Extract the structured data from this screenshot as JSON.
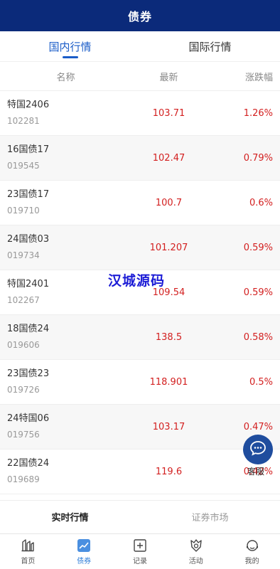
{
  "header": {
    "title": "债券"
  },
  "tabs": [
    {
      "label": "国内行情",
      "active": true
    },
    {
      "label": "国际行情",
      "active": false
    }
  ],
  "columns": {
    "name": "名称",
    "latest": "最新",
    "change": "涨跌幅"
  },
  "rows": [
    {
      "name": "特国2406",
      "code": "102281",
      "price": "103.71",
      "change": "1.26%"
    },
    {
      "name": "16国债17",
      "code": "019545",
      "price": "102.47",
      "change": "0.79%"
    },
    {
      "name": "23国债17",
      "code": "019710",
      "price": "100.7",
      "change": "0.6%"
    },
    {
      "name": "24国债03",
      "code": "019734",
      "price": "101.207",
      "change": "0.59%"
    },
    {
      "name": "特国2401",
      "code": "102267",
      "price": "109.54",
      "change": "0.59%"
    },
    {
      "name": "18国债24",
      "code": "019606",
      "price": "138.5",
      "change": "0.58%"
    },
    {
      "name": "23国债23",
      "code": "019726",
      "price": "118.901",
      "change": "0.5%"
    },
    {
      "name": "24特国06",
      "code": "019756",
      "price": "103.17",
      "change": "0.47%"
    },
    {
      "name": "22国债24",
      "code": "019689",
      "price": "119.6",
      "change": "0.42%"
    }
  ],
  "watermark": "汉城源码",
  "chat": {
    "label": "客服",
    "icon": "chat-bubble-icon"
  },
  "subtabs": [
    {
      "label": "实时行情",
      "active": true
    },
    {
      "label": "证券市场",
      "active": false
    }
  ],
  "nav": [
    {
      "label": "首页",
      "icon": "home-icon",
      "active": false
    },
    {
      "label": "债券",
      "icon": "trend-chart-icon",
      "active": true
    },
    {
      "label": "记录",
      "icon": "plus-square-icon",
      "active": false
    },
    {
      "label": "活动",
      "icon": "badge-icon",
      "active": false
    },
    {
      "label": "我的",
      "icon": "user-headset-icon",
      "active": false
    }
  ],
  "colors": {
    "header_bg": "#0b2a7a",
    "accent": "#1a5cc8",
    "up": "#d32020",
    "chat_bg": "#1f4d9e"
  }
}
